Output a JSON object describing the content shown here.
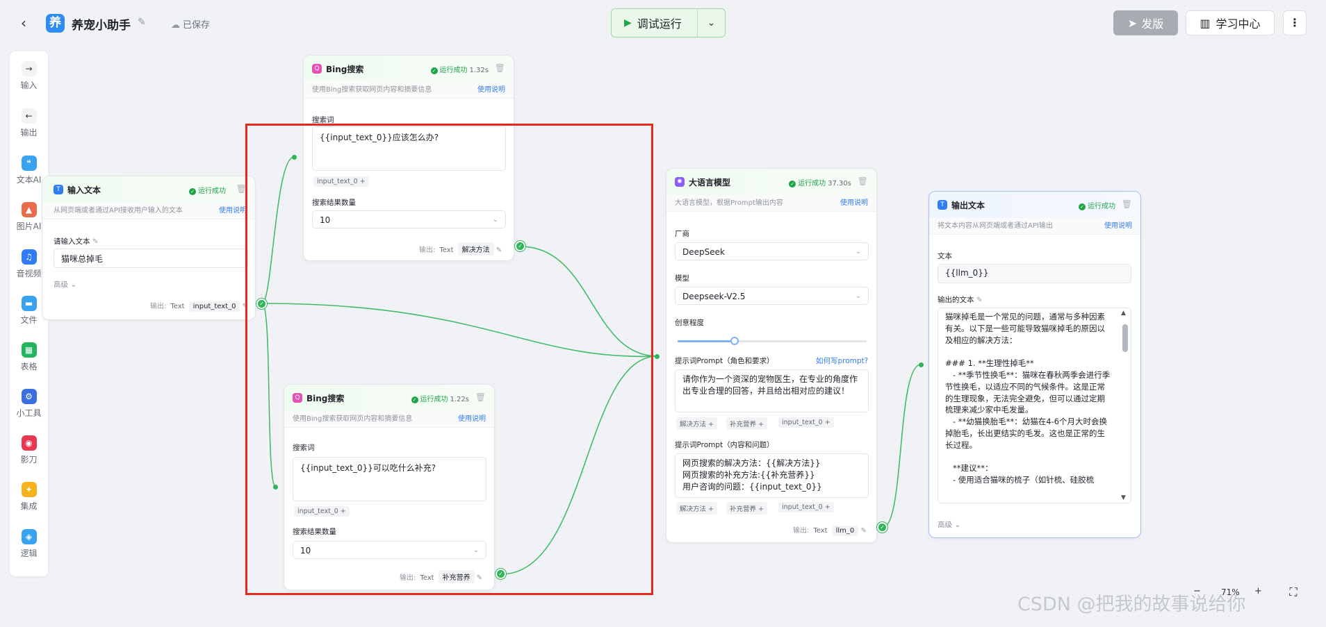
{
  "header": {
    "back_icon": "back-arrow-icon",
    "app_logo": "养",
    "app_name": "养宠小助手",
    "saved": "已保存",
    "run_label": "调试运行",
    "publish_label": "发版",
    "learn_label": "学习中心",
    "colors": {
      "run_bg": "#eaf8ec",
      "run_accent": "#1ea548",
      "publish_bg": "#a7acb3"
    }
  },
  "toolbar": {
    "items": [
      {
        "label": "输入",
        "icon": "input-arrow-icon",
        "color": "#ffffff"
      },
      {
        "label": "输出",
        "icon": "output-arrow-icon",
        "color": "#ffffff"
      },
      {
        "label": "文本AI",
        "icon": "quote-icon",
        "color": "#3aa3f0"
      },
      {
        "label": "图片AI",
        "icon": "image-icon",
        "color": "#e86b4a"
      },
      {
        "label": "音视频",
        "icon": "music-icon",
        "color": "#2f7cf6"
      },
      {
        "label": "文件",
        "icon": "folder-icon",
        "color": "#3aa3f0"
      },
      {
        "label": "表格",
        "icon": "table-icon",
        "color": "#23b45e"
      },
      {
        "label": "小工具",
        "icon": "tool-icon",
        "color": "#3b6fe0"
      },
      {
        "label": "影刀",
        "icon": "blade-icon",
        "color": "#e8384f"
      },
      {
        "label": "集成",
        "icon": "puzzle-icon",
        "color": "#f5b21d"
      },
      {
        "label": "逻辑",
        "icon": "logic-icon",
        "color": "#3aa3f0"
      }
    ]
  },
  "nodes": {
    "input": {
      "title": "输入文本",
      "status": "运行成功",
      "desc": "从网页端或者通过API接收用户输入的文本",
      "help": "使用说明",
      "field_label": "请输入文本",
      "value": "猫咪总掉毛",
      "advanced": "高级",
      "out_label": "输出:",
      "out_type": "Text",
      "out_name": "input_text_0"
    },
    "bing1": {
      "title": "Bing搜索",
      "status": "运行成功",
      "time": "1.32s",
      "desc": "使用Bing搜索获取网页内容和摘要信息",
      "help": "使用说明",
      "query_label": "搜索词",
      "query": "{{input_text_0}}应该怎么办?",
      "var_tag": "input_text_0",
      "count_label": "搜索结果数量",
      "count": "10",
      "out_label": "输出:",
      "out_type": "Text",
      "out_name": "解决方法"
    },
    "bing2": {
      "title": "Bing搜索",
      "status": "运行成功",
      "time": "1.22s",
      "desc": "使用Bing搜索获取网页内容和摘要信息",
      "help": "使用说明",
      "query_label": "搜索词",
      "query": "{{input_text_0}}可以吃什么补充?",
      "var_tag": "input_text_0",
      "count_label": "搜索结果数量",
      "count": "10",
      "out_label": "输出:",
      "out_type": "Text",
      "out_name": "补充营养"
    },
    "llm": {
      "title": "大语言模型",
      "status": "运行成功",
      "time": "37.30s",
      "desc": "大语言模型，根据Prompt输出内容",
      "help": "使用说明",
      "vendor_label": "厂商",
      "vendor": "DeepSeek",
      "model_label": "模型",
      "model": "Deepseek-V2.5",
      "creativity_label": "创意程度",
      "creativity": 0.3,
      "prompt1_label": "提示词Prompt（角色和要求）",
      "prompt1_link": "如何写prompt?",
      "prompt1": "请你作为一个资深的宠物医生，在专业的角度作出专业合理的回答，并且给出相对应的建议！",
      "tags1": [
        "解决方法",
        "补充营养",
        "input_text_0"
      ],
      "prompt2_label": "提示词Prompt（内容和问题）",
      "prompt2_lines": [
        "网页搜索的解决方法：{{解决方法}}",
        "网页搜索的补充方法:{{补充营养}}",
        "用户咨询的问题：{{input_text_0}}"
      ],
      "tags2": [
        "解决方法",
        "补充营养",
        "input_text_0"
      ],
      "out_label": "输出:",
      "out_type": "Text",
      "out_name": "llm_0"
    },
    "output": {
      "title": "输出文本",
      "status": "运行成功",
      "desc": "将文本内容从网页端或者通过API输出",
      "help": "使用说明",
      "text_label": "文本",
      "text_value": "{{llm_0}}",
      "output_label": "输出的文本",
      "output_lines": [
        "猫咪掉毛是一个常见的问题，通常与多种因素",
        "有关。以下是一些可能导致猫咪掉毛的原因以",
        "及相应的解决方法：",
        "",
        "### 1. **生理性掉毛**",
        "   - **季节性换毛**：猫咪在春秋两季会进行季",
        "节性换毛，以适应不同的气候条件。这是正常",
        "的生理现象，无法完全避免，但可以通过定期",
        "梳理来减少家中毛发量。",
        "   - **幼猫换胎毛**：幼猫在4-6个月大时会换",
        "掉胎毛，长出更结实的毛发。这也是正常的生",
        "长过程。",
        "",
        "   **建议**：",
        "   - 使用适合猫咪的梳子（如针梳、硅胶梳"
      ],
      "advanced": "高级"
    }
  },
  "zoom": {
    "percent": "71%"
  },
  "watermark": "CSDN @把我的故事说给你"
}
